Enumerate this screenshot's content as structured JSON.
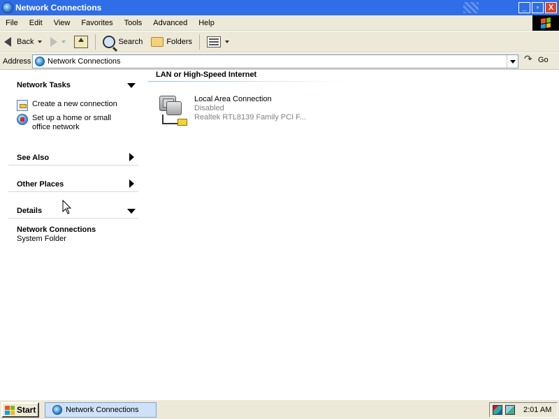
{
  "window": {
    "title": "Network Connections",
    "controls": {
      "minimize": "_",
      "maximize": "▫",
      "close": "X"
    }
  },
  "menubar": [
    "File",
    "Edit",
    "View",
    "Favorites",
    "Tools",
    "Advanced",
    "Help"
  ],
  "toolbar": {
    "back": "Back",
    "search": "Search",
    "folders": "Folders"
  },
  "address": {
    "label": "Address",
    "value": "Network Connections",
    "go": "Go"
  },
  "taskpane": {
    "network_tasks": {
      "title": "Network Tasks",
      "items": [
        "Create a new connection",
        "Set up a home or small office network"
      ]
    },
    "see_also": {
      "title": "See Also"
    },
    "other_places": {
      "title": "Other Places"
    },
    "details": {
      "title": "Details",
      "name": "Network Connections",
      "type": "System Folder"
    }
  },
  "content": {
    "group_title": "LAN or High-Speed Internet",
    "items": [
      {
        "name": "Local Area Connection",
        "status": "Disabled",
        "device": "Realtek RTL8139 Family PCI F..."
      }
    ]
  },
  "taskbar": {
    "start": "Start",
    "window_button": "Network Connections",
    "clock": "2:01 AM"
  },
  "colors": {
    "titlebar": "#2f6ee6",
    "chrome": "#ece9d8",
    "disabled_text": "#808080"
  }
}
